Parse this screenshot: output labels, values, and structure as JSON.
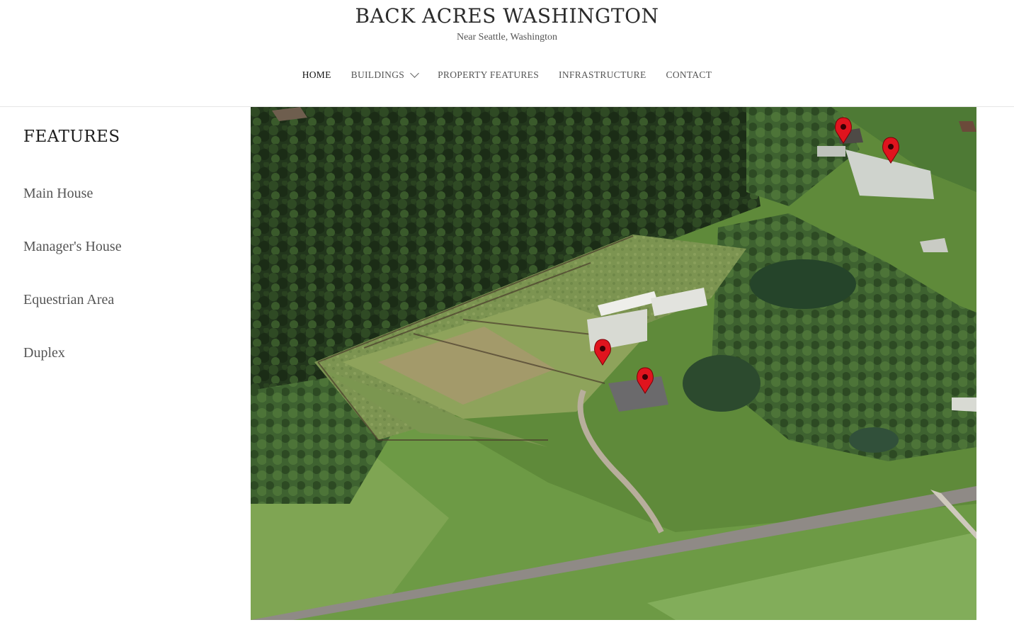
{
  "site": {
    "title": "BACK ACRES WASHINGTON",
    "tagline": "Near Seattle, Washington"
  },
  "nav": {
    "items": [
      {
        "label": "HOME",
        "active": true
      },
      {
        "label": "BUILDINGS",
        "has_dropdown": true
      },
      {
        "label": "PROPERTY FEATURES"
      },
      {
        "label": "INFRASTRUCTURE"
      },
      {
        "label": "CONTACT"
      }
    ],
    "dropdown_icon": "chevron-down-icon"
  },
  "sidebar": {
    "title": "FEATURES",
    "items": [
      {
        "label": "Main House"
      },
      {
        "label": "Manager's House"
      },
      {
        "label": "Equestrian Area"
      },
      {
        "label": "Duplex"
      }
    ]
  },
  "map": {
    "marker_icon": "map-pin-icon",
    "marker_color": "#e0141e",
    "marker_count": 4
  },
  "colors": {
    "text": "#333333",
    "nav_active": "#111111",
    "border": "#e6e6e6"
  }
}
